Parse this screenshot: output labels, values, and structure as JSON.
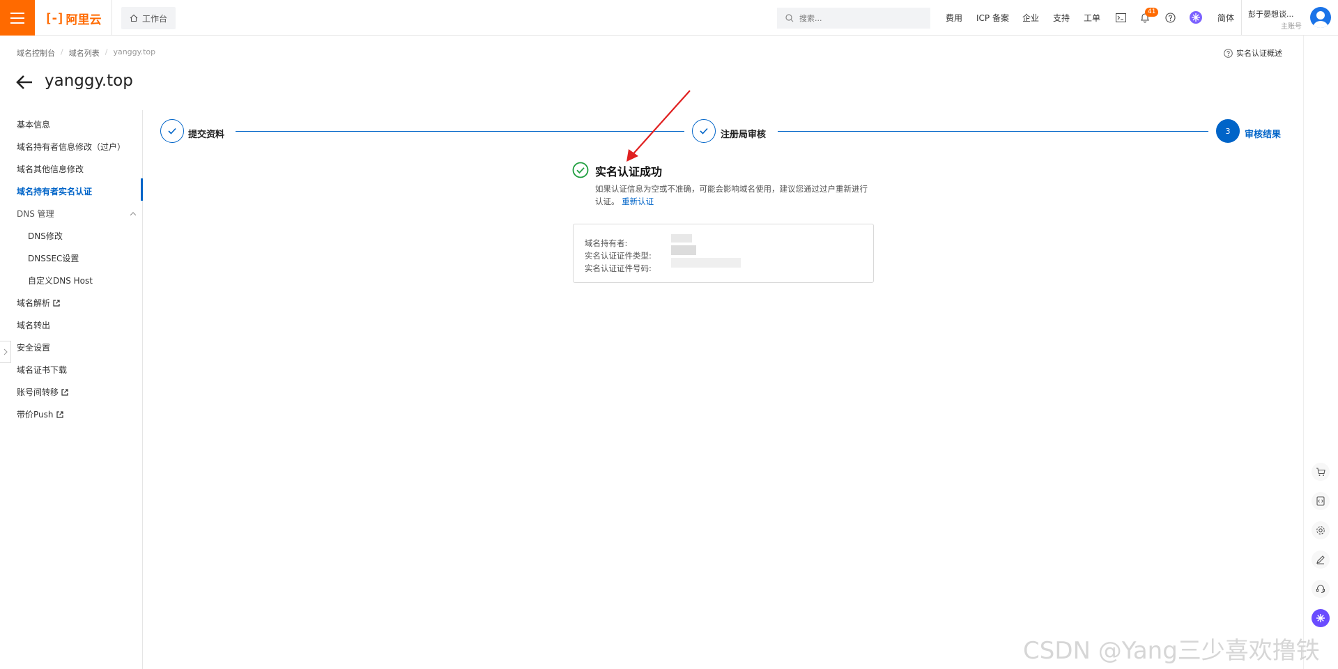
{
  "header": {
    "logo_text": "阿里云",
    "workbench": "工作台",
    "search_placeholder": "搜索...",
    "nav": [
      "费用",
      "ICP 备案",
      "企业",
      "支持",
      "工单"
    ],
    "notification_count": "41",
    "language": "简体",
    "user_name": "彭于晏想谈...",
    "user_role": "主账号",
    "accent_color": "#ff6a00"
  },
  "breadcrumb": [
    "域名控制台",
    "域名列表",
    "yanggy.top"
  ],
  "help_link": "实名认证概述",
  "page_title": "yanggy.top",
  "sidebar": {
    "items": [
      {
        "label": "基本信息"
      },
      {
        "label": "域名持有者信息修改（过户）"
      },
      {
        "label": "域名其他信息修改"
      },
      {
        "label": "域名持有者实名认证",
        "active": true
      },
      {
        "label": "DNS 管理"
      },
      {
        "label": "DNS修改"
      },
      {
        "label": "DNSSEC设置"
      },
      {
        "label": "自定义DNS Host"
      },
      {
        "label": "域名解析"
      },
      {
        "label": "域名转出"
      },
      {
        "label": "安全设置"
      },
      {
        "label": "域名证书下载"
      },
      {
        "label": "账号间转移"
      },
      {
        "label": "带价Push"
      }
    ]
  },
  "steps": [
    {
      "label": "提交资料",
      "state": "done"
    },
    {
      "label": "注册局审核",
      "state": "done"
    },
    {
      "label": "审核结果",
      "state": "current",
      "number": "3"
    }
  ],
  "result": {
    "title": "实名认证成功",
    "desc": "如果认证信息为空或不准确，可能会影响域名使用，建议您通过过户重新进行认证。",
    "link": "重新认证",
    "fields": [
      "域名持有者:",
      "实名认证证件类型:",
      "实名认证证件号码:"
    ]
  },
  "watermark": "CSDN @Yang三少喜欢撸铁"
}
